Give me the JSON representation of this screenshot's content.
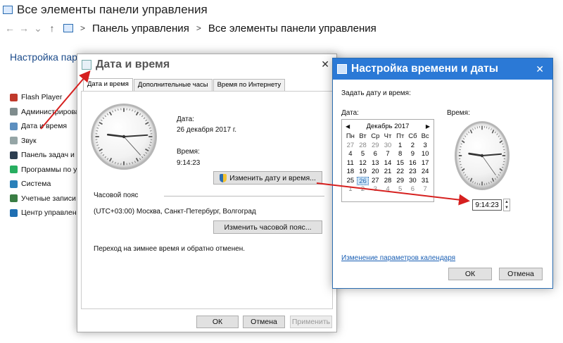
{
  "window": {
    "title": "Все элементы панели управления",
    "nav_back": "←",
    "nav_forward": "→",
    "nav_recent": "⌄",
    "nav_up": "↑"
  },
  "breadcrumb": {
    "sep1": ">",
    "item1": "Панель управления",
    "sep2": ">",
    "item2": "Все элементы панели управления"
  },
  "left": {
    "title": "Настройка пара",
    "items": [
      {
        "label": "Flash Player",
        "color": "#c0392b"
      },
      {
        "label": "Администрирова",
        "color": "#7f8c8d"
      },
      {
        "label": "Дата и время",
        "color": "#5d8fbf"
      },
      {
        "label": "Звук",
        "color": "#95a5a6"
      },
      {
        "label": "Панель задач и н",
        "color": "#2c3e50"
      },
      {
        "label": "Программы по ум",
        "color": "#27ae60"
      },
      {
        "label": "Система",
        "color": "#2980b9"
      },
      {
        "label": "Учетные записи п",
        "color": "#3a7d44"
      },
      {
        "label": "Центр управлени",
        "color": "#1f6fb2"
      }
    ]
  },
  "dialog1": {
    "title": "Дата и время",
    "close": "✕",
    "tabs": [
      "Дата и время",
      "Дополнительные часы",
      "Время по Интернету"
    ],
    "date_label": "Дата:",
    "date_value": "26 декабря 2017 г.",
    "time_label": "Время:",
    "time_value": "9:14:23",
    "change_datetime_button": "Изменить дату и время...",
    "timezone_label": "Часовой пояс",
    "timezone_value": "(UTC+03:00) Москва, Санкт-Петербург, Волгоград",
    "change_timezone_button": "Изменить часовой пояс...",
    "dst_note": "Переход на зимнее время и обратно отменен.",
    "ok": "ОК",
    "cancel": "Отмена",
    "apply": "Применить"
  },
  "dialog2": {
    "title": "Настройка времени и даты",
    "close": "✕",
    "set_label": "Задать дату и время:",
    "date_label": "Дата:",
    "time_label": "Время:",
    "month": "Декабрь 2017",
    "prev": "◀",
    "next": "▶",
    "weekdays": [
      "Пн",
      "Вт",
      "Ср",
      "Чт",
      "Пт",
      "Сб",
      "Вс"
    ],
    "weeks": [
      [
        "27",
        "28",
        "29",
        "30",
        "1",
        "2",
        "3"
      ],
      [
        "4",
        "5",
        "6",
        "7",
        "8",
        "9",
        "10"
      ],
      [
        "11",
        "12",
        "13",
        "14",
        "15",
        "16",
        "17"
      ],
      [
        "18",
        "19",
        "20",
        "21",
        "22",
        "23",
        "24"
      ],
      [
        "25",
        "26",
        "27",
        "28",
        "29",
        "30",
        "31"
      ],
      [
        "1",
        "2",
        "3",
        "4",
        "5",
        "6",
        "7"
      ]
    ],
    "selected_day": "26",
    "time_value": "9:14:23",
    "spin_up": "▲",
    "spin_down": "▼",
    "calendar_link": "Изменение параметров календаря",
    "ok": "ОК",
    "cancel": "Отмена"
  },
  "clock": {
    "hour": 9,
    "minute": 14,
    "second": 23
  },
  "colors": {
    "accent": "#2b79d6",
    "arrow": "#d6201f"
  }
}
